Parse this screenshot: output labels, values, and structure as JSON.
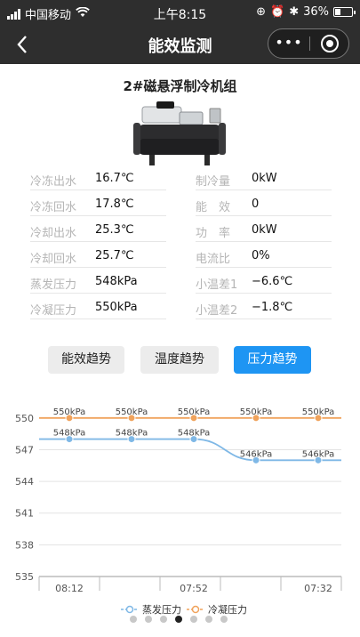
{
  "statusbar": {
    "carrier": "中国移动",
    "time": "上午8:15",
    "battery": "36%",
    "battery_level": 0.36
  },
  "navbar": {
    "back_icon": "chevron-left-icon",
    "title": "能效监测",
    "more_icon": "more-dots-icon",
    "close_icon": "target-circle-icon"
  },
  "unit": {
    "title": "2#磁悬浮制冷机组"
  },
  "params": {
    "left": [
      {
        "label": "冷冻出水",
        "value": "16.7℃"
      },
      {
        "label": "冷冻回水",
        "value": "17.8℃"
      },
      {
        "label": "冷却出水",
        "value": "25.3℃"
      },
      {
        "label": "冷却回水",
        "value": "25.7℃"
      },
      {
        "label": "蒸发压力",
        "value": "548kPa"
      },
      {
        "label": "冷凝压力",
        "value": "550kPa"
      }
    ],
    "right": [
      {
        "label": "制冷量",
        "value": "0kW"
      },
      {
        "label": "能　效",
        "value": "0"
      },
      {
        "label": "功　率",
        "value": "0kW"
      },
      {
        "label": "电流比",
        "value": "0%"
      },
      {
        "label": "小温差1",
        "value": "−6.6℃"
      },
      {
        "label": "小温差2",
        "value": "−1.8℃"
      }
    ]
  },
  "tabs": [
    {
      "label": "能效趋势",
      "active": false
    },
    {
      "label": "温度趋势",
      "active": false
    },
    {
      "label": "压力趋势",
      "active": true
    }
  ],
  "chart_data": {
    "type": "line",
    "x": [
      "08:12",
      "",
      "07:52",
      "",
      "07:32"
    ],
    "ylim": [
      535,
      551.5
    ],
    "yticks": [
      535,
      538,
      541,
      544,
      547,
      550
    ],
    "grid": true,
    "legend_position": "bottom",
    "series": [
      {
        "name": "蒸发压力",
        "color": "#7fb8e6",
        "values": [
          548,
          548,
          548,
          546,
          546
        ],
        "labels": [
          "548kPa",
          "548kPa",
          "548kPa",
          "546kPa",
          "546kPa"
        ]
      },
      {
        "name": "冷凝压力",
        "color": "#f0a35c",
        "values": [
          550,
          550,
          550,
          550,
          550
        ],
        "labels": [
          "550kPa",
          "550kPa",
          "550kPa",
          "550kPa",
          "550kPa"
        ]
      }
    ],
    "page_dots": {
      "count": 7,
      "active": 3
    }
  },
  "colors": {
    "header_bg": "#2e2e2e",
    "accent": "#1e95f3",
    "tab_bg": "#ececec"
  }
}
